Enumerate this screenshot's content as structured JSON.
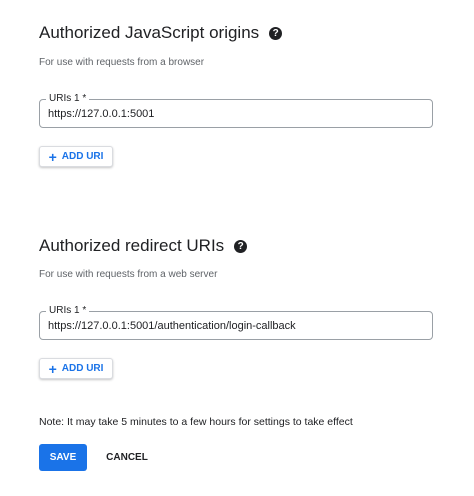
{
  "js_origins": {
    "title": "Authorized JavaScript origins",
    "help_icon": "?",
    "subtitle": "For use with requests from a browser",
    "uri_label": "URIs 1 *",
    "uri_value": "https://127.0.0.1:5001",
    "add_button_icon": "+",
    "add_button_label": "ADD URI"
  },
  "redirect_uris": {
    "title": "Authorized redirect URIs",
    "help_icon": "?",
    "subtitle": "For use with requests from a web server",
    "uri_label": "URIs 1 *",
    "uri_value": "https://127.0.0.1:5001/authentication/login-callback",
    "add_button_icon": "+",
    "add_button_label": "ADD URI"
  },
  "note": "Note: It may take 5 minutes to a few hours for settings to take effect",
  "actions": {
    "save_label": "SAVE",
    "cancel_label": "CANCEL"
  },
  "colors": {
    "accent": "#1a73e8",
    "text": "#202124",
    "muted": "#5f6368",
    "field_border": "#9aa0a6"
  }
}
